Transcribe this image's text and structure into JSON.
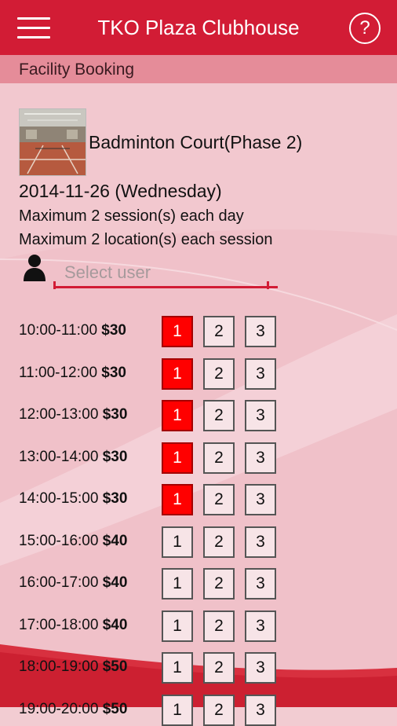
{
  "header": {
    "title": "TKO Plaza Clubhouse",
    "help_label": "?"
  },
  "subheader": {
    "title": "Facility Booking"
  },
  "facility": {
    "name": "Badminton Court(Phase 2)",
    "date": "2014-11-26 (Wednesday)",
    "rule_sessions": "Maximum 2 session(s) each day",
    "rule_locations": "Maximum 2 location(s) each session"
  },
  "user_select": {
    "placeholder": "Select user"
  },
  "colors": {
    "accent": "#d21c35",
    "booked": "#ff0000",
    "page_bg": "#f2ccd2"
  },
  "slots": [
    {
      "time": "10:00-11:00",
      "price": "$30",
      "courts": [
        {
          "label": "1",
          "booked": true
        },
        {
          "label": "2",
          "booked": false
        },
        {
          "label": "3",
          "booked": false
        }
      ]
    },
    {
      "time": "11:00-12:00",
      "price": "$30",
      "courts": [
        {
          "label": "1",
          "booked": true
        },
        {
          "label": "2",
          "booked": false
        },
        {
          "label": "3",
          "booked": false
        }
      ]
    },
    {
      "time": "12:00-13:00",
      "price": "$30",
      "courts": [
        {
          "label": "1",
          "booked": true
        },
        {
          "label": "2",
          "booked": false
        },
        {
          "label": "3",
          "booked": false
        }
      ]
    },
    {
      "time": "13:00-14:00",
      "price": "$30",
      "courts": [
        {
          "label": "1",
          "booked": true
        },
        {
          "label": "2",
          "booked": false
        },
        {
          "label": "3",
          "booked": false
        }
      ]
    },
    {
      "time": "14:00-15:00",
      "price": "$30",
      "courts": [
        {
          "label": "1",
          "booked": true
        },
        {
          "label": "2",
          "booked": false
        },
        {
          "label": "3",
          "booked": false
        }
      ]
    },
    {
      "time": "15:00-16:00",
      "price": "$40",
      "courts": [
        {
          "label": "1",
          "booked": false
        },
        {
          "label": "2",
          "booked": false
        },
        {
          "label": "3",
          "booked": false
        }
      ]
    },
    {
      "time": "16:00-17:00",
      "price": "$40",
      "courts": [
        {
          "label": "1",
          "booked": false
        },
        {
          "label": "2",
          "booked": false
        },
        {
          "label": "3",
          "booked": false
        }
      ]
    },
    {
      "time": "17:00-18:00",
      "price": "$40",
      "courts": [
        {
          "label": "1",
          "booked": false
        },
        {
          "label": "2",
          "booked": false
        },
        {
          "label": "3",
          "booked": false
        }
      ]
    },
    {
      "time": "18:00-19:00",
      "price": "$50",
      "courts": [
        {
          "label": "1",
          "booked": false
        },
        {
          "label": "2",
          "booked": false
        },
        {
          "label": "3",
          "booked": false
        }
      ]
    },
    {
      "time": "19:00-20:00",
      "price": "$50",
      "courts": [
        {
          "label": "1",
          "booked": false
        },
        {
          "label": "2",
          "booked": false
        },
        {
          "label": "3",
          "booked": false
        }
      ]
    }
  ]
}
